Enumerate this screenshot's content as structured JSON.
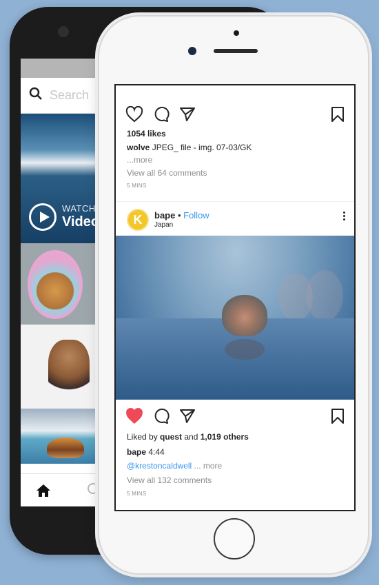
{
  "back_phone": {
    "search_placeholder": "Search",
    "video_tile": {
      "watch_label": "WATCH",
      "video_label": "Video"
    },
    "icons": {
      "search": "search-icon",
      "play": "play-icon",
      "home": "home-icon"
    }
  },
  "front_phone": {
    "prev_post": {
      "likes": "1054 likes",
      "caption_user": "wolve",
      "caption_text": "JPEG_ file - img. 07-03/GK",
      "more": "...more",
      "view_comments": "View all 64 comments",
      "time": "5 MINS"
    },
    "post": {
      "avatar_letter": "K",
      "username": "bape",
      "follow_sep": " • ",
      "follow": "Follow",
      "location": "Japan",
      "liked_by_prefix": "Liked by ",
      "liked_by_user": "quest",
      "liked_by_mid": " and ",
      "liked_by_count": "1,019 others",
      "caption_user": "bape",
      "caption_text": "4:44",
      "mention": "@krestoncaldwell",
      "more": " ... more",
      "view_comments": "View all 132 comments",
      "time": "5 MINS"
    },
    "icons": {
      "like": "heart-icon",
      "liked": "heart-filled-icon",
      "comment": "comment-icon",
      "share": "send-icon",
      "save": "bookmark-icon",
      "menu": "more-vertical-icon"
    },
    "colors": {
      "liked_heart": "#ed4956",
      "link_blue": "#3897f0",
      "avatar_yellow": "#f3c629"
    }
  }
}
